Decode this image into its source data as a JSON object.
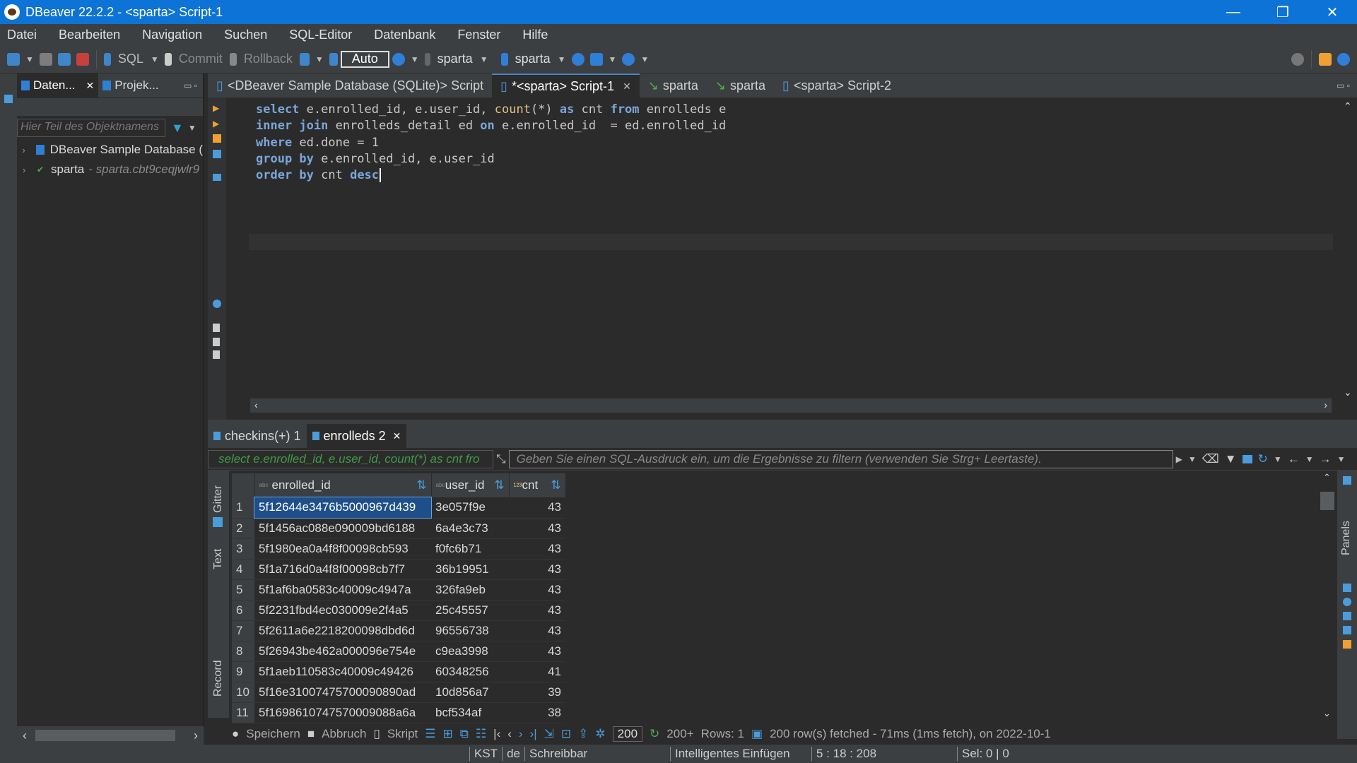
{
  "window": {
    "title": "DBeaver 22.2.2 - <sparta> Script-1",
    "controls": [
      "—",
      "❐",
      "✕"
    ]
  },
  "menu": [
    "Datei",
    "Bearbeiten",
    "Navigation",
    "Suchen",
    "SQL-Editor",
    "Datenbank",
    "Fenster",
    "Hilfe"
  ],
  "toolbar": {
    "sql": "SQL",
    "commit": "Commit",
    "rollback": "Rollback",
    "auto": "Auto",
    "datasource": "sparta",
    "schema": "sparta"
  },
  "navigator": {
    "tabs": [
      "Daten...",
      "Projek..."
    ],
    "filter_placeholder": "Hier Teil des Objektnamens",
    "items": [
      {
        "label": "DBeaver Sample Database (",
        "sub": ""
      },
      {
        "label": "sparta",
        "sub": "- sparta.cbt9ceqjwlr9"
      }
    ]
  },
  "editor": {
    "tabs": [
      "<DBeaver Sample Database (SQLite)> Script",
      "*<sparta> Script-1",
      "sparta",
      "sparta",
      "<sparta> Script-2"
    ],
    "code": [
      [
        "select",
        " e.enrolled_id, e.user_id, ",
        "count",
        "(*) ",
        "as",
        " cnt ",
        "from",
        " enrolleds e"
      ],
      [
        "inner join",
        " enrolleds_detail ed ",
        "on",
        " e.enrolled_id  = ed.enrolled_id"
      ],
      [
        "where",
        " ed.done = 1"
      ],
      [
        "group by",
        " e.enrolled_id, e.user_id"
      ],
      [
        "order by",
        " cnt ",
        "desc"
      ]
    ]
  },
  "results": {
    "tabs": [
      "checkins(+) 1",
      "enrolleds 2"
    ],
    "query_preview": "select e.enrolled_id, e.user_id, count(*) as cnt fro",
    "filter_placeholder": "Geben Sie einen SQL-Ausdruck ein, um die Ergebnisse zu filtern (verwenden Sie Strg+ Leertaste).",
    "side_tabs": [
      "Gitter",
      "Text",
      "Record"
    ],
    "right_panel": "Panels",
    "columns": [
      "enrolled_id",
      "user_id",
      "cnt"
    ],
    "rows": [
      [
        "1",
        "5f12644e3476b5000967d439",
        "3e057f9e",
        "43"
      ],
      [
        "2",
        "5f1456ac088e090009bd6188",
        "6a4e3c73",
        "43"
      ],
      [
        "3",
        "5f1980ea0a4f8f00098cb593",
        "f0fc6b71",
        "43"
      ],
      [
        "4",
        "5f1a716d0a4f8f00098cb7f7",
        "36b19951",
        "43"
      ],
      [
        "5",
        "5f1af6ba0583c40009c4947a",
        "326fa9eb",
        "43"
      ],
      [
        "6",
        "5f2231fbd4ec030009e2f4a5",
        "25c45557",
        "43"
      ],
      [
        "7",
        "5f2611a6e2218200098dbd6d",
        "96556738",
        "43"
      ],
      [
        "8",
        "5f26943be462a000096e754e",
        "c9ea3998",
        "43"
      ],
      [
        "9",
        "5f1aeb110583c40009c49426",
        "60348256",
        "41"
      ],
      [
        "10",
        "5f16e31007475700090890ad",
        "10d856a7",
        "39"
      ],
      [
        "11",
        "5f1698610747570009088a6a",
        "bcf534af",
        "38"
      ]
    ],
    "status": {
      "save": "Speichern",
      "cancel": "Abbruch",
      "script": "Skript",
      "fetch_size": "200",
      "fetched": "200+",
      "rows": "Rows: 1",
      "message": "200 row(s) fetched - 71ms (1ms fetch), on 2022-10-1"
    }
  },
  "statusbar": {
    "timezone": "KST",
    "locale": "de",
    "mode": "Schreibbar",
    "insert": "Intelligentes Einfügen",
    "position": "5 : 18 : 208",
    "selection": "Sel: 0 | 0"
  }
}
